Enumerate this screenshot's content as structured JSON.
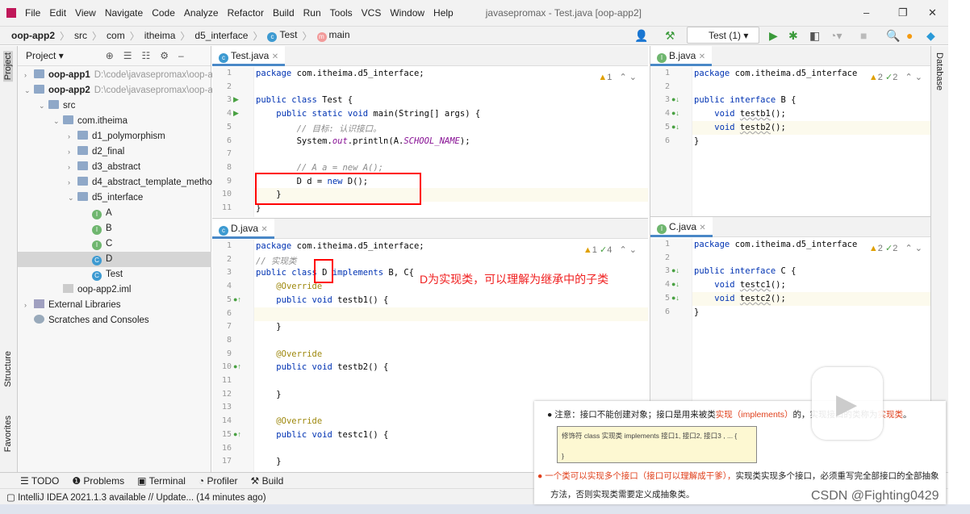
{
  "menu": {
    "items": [
      "File",
      "Edit",
      "View",
      "Navigate",
      "Code",
      "Analyze",
      "Refactor",
      "Build",
      "Run",
      "Tools",
      "VCS",
      "Window",
      "Help"
    ],
    "title": "javasepromax - Test.java [oop-app2]"
  },
  "breadcrumb": [
    "oop-app2",
    "src",
    "com",
    "itheima",
    "d5_interface",
    "Test",
    "main"
  ],
  "toolbar": {
    "run_config": "Test (1)"
  },
  "sidebar": {
    "project_label": "Project",
    "structure_label": "Structure",
    "favorites_label": "Favorites",
    "database_label": "Database"
  },
  "tree": [
    {
      "label": "oop-app1",
      "path": "D:\\code\\javasepromax\\oop-a",
      "indent": 0,
      "arrow": "›",
      "icon": "module",
      "bold": true
    },
    {
      "label": "oop-app2",
      "path": "D:\\code\\javasepromax\\oop-a",
      "indent": 0,
      "arrow": "⌄",
      "icon": "module",
      "bold": true
    },
    {
      "label": "src",
      "indent": 1,
      "arrow": "⌄",
      "icon": "folder"
    },
    {
      "label": "com.itheima",
      "indent": 2,
      "arrow": "⌄",
      "icon": "folder"
    },
    {
      "label": "d1_polymorphism",
      "indent": 3,
      "arrow": "›",
      "icon": "folder"
    },
    {
      "label": "d2_final",
      "indent": 3,
      "arrow": "›",
      "icon": "folder"
    },
    {
      "label": "d3_abstract",
      "indent": 3,
      "arrow": "›",
      "icon": "folder"
    },
    {
      "label": "d4_abstract_template_metho",
      "indent": 3,
      "arrow": "›",
      "icon": "folder"
    },
    {
      "label": "d5_interface",
      "indent": 3,
      "arrow": "⌄",
      "icon": "folder"
    },
    {
      "label": "A",
      "indent": 4,
      "icon": "interface"
    },
    {
      "label": "B",
      "indent": 4,
      "icon": "interface"
    },
    {
      "label": "C",
      "indent": 4,
      "icon": "interface"
    },
    {
      "label": "D",
      "indent": 4,
      "icon": "class",
      "selected": true
    },
    {
      "label": "Test",
      "indent": 4,
      "icon": "class"
    },
    {
      "label": "oop-app2.iml",
      "indent": 2,
      "icon": "file"
    },
    {
      "label": "External Libraries",
      "indent": 0,
      "arrow": "›",
      "icon": "lib"
    },
    {
      "label": "Scratches and Consoles",
      "indent": 0,
      "icon": "scratch"
    }
  ],
  "editors": {
    "test": {
      "tab": "Test.java",
      "warnings": "1",
      "lines": [
        "<span class=kw>package</span> com.itheima.d5_interface;",
        "",
        "<span class=kw>public class</span> Test {",
        "    <span class=kw>public static void</span> main(String[] args) {",
        "        <span class=cm>// 目标: 认识接口。</span>",
        "        System.<span class=it>out</span>.println(A.<span class=it>SCHOOL_NAME</span>);",
        "",
        "        <span class=cm>// A a = new A();</span>",
        "        D d = <span class=kw>new</span> D();",
        "    }",
        "}"
      ]
    },
    "d": {
      "tab": "D.java",
      "warnings": "1",
      "checks": "4",
      "lines": [
        "<span class=kw>package</span> com.itheima.d5_interface;",
        "<span class=cm>// 实现类</span>",
        "<span class=kw>public class</span> D <span class=kw>implements</span> B, C{",
        "    <span style=color:#9e880d>@Override</span>",
        "    <span class=kw>public void</span> testb1() {",
        "",
        "    }",
        "",
        "    <span style=color:#9e880d>@Override</span>",
        "    <span class=kw>public void</span> testb2() {",
        "",
        "    }",
        "",
        "    <span style=color:#9e880d>@Override</span>",
        "    <span class=kw>public void</span> testc1() {",
        "",
        "    }"
      ]
    },
    "b": {
      "tab": "B.java",
      "warnings": "2",
      "checks": "2",
      "lines": [
        "<span class=kw>package</span> com.itheima.d5_interface",
        "",
        "<span class=kw>public interface</span> B {",
        "    <span class=kw>void</span> <span class=un>testb1</span>();",
        "    <span class=kw>void</span> <span class=un>testb2</span>();",
        "}"
      ]
    },
    "c": {
      "tab": "C.java",
      "warnings": "2",
      "checks": "2",
      "lines": [
        "<span class=kw>package</span> com.itheima.d5_interface",
        "",
        "<span class=kw>public interface</span> C {",
        "    <span class=kw>void</span> <span class=un>testc1</span>();",
        "    <span class=kw>void</span> <span class=un>testc2</span>();",
        "}"
      ]
    }
  },
  "annotation": "D为实现类，可以理解为继承中的子类",
  "bottom_tabs": [
    "☰ TODO",
    "❶ Problems",
    "▣ Terminal",
    "◔ Profiler",
    "⚒ Build"
  ],
  "status": "IntelliJ IDEA 2021.1.3 available // Update... (14 minutes ago)",
  "slide": {
    "note_prefix": "注意：接口不能创建对象；接口是用来被类",
    "note_red": "实现（implements）",
    "note_suffix": "的，实现接口的类称为",
    "note_red2": "实现类",
    "note_end": "。",
    "code_line1": "修饰符 class 实现类 implements 接口1, 接口2, 接口3 , ... {",
    "code_line2": "}",
    "point2_red": "一个类可以实现多个接口（接口可以理解成干爹），",
    "point2": "实现类实现多个接口，必须重写完全部接口的全部抽象",
    "point2_cont": "方法，否则实现类需要定义成抽象类。"
  },
  "watermark": "CSDN @Fighting0429",
  "colors": {
    "accent": "#4a88c7",
    "annotation_red": "#ff0000"
  }
}
